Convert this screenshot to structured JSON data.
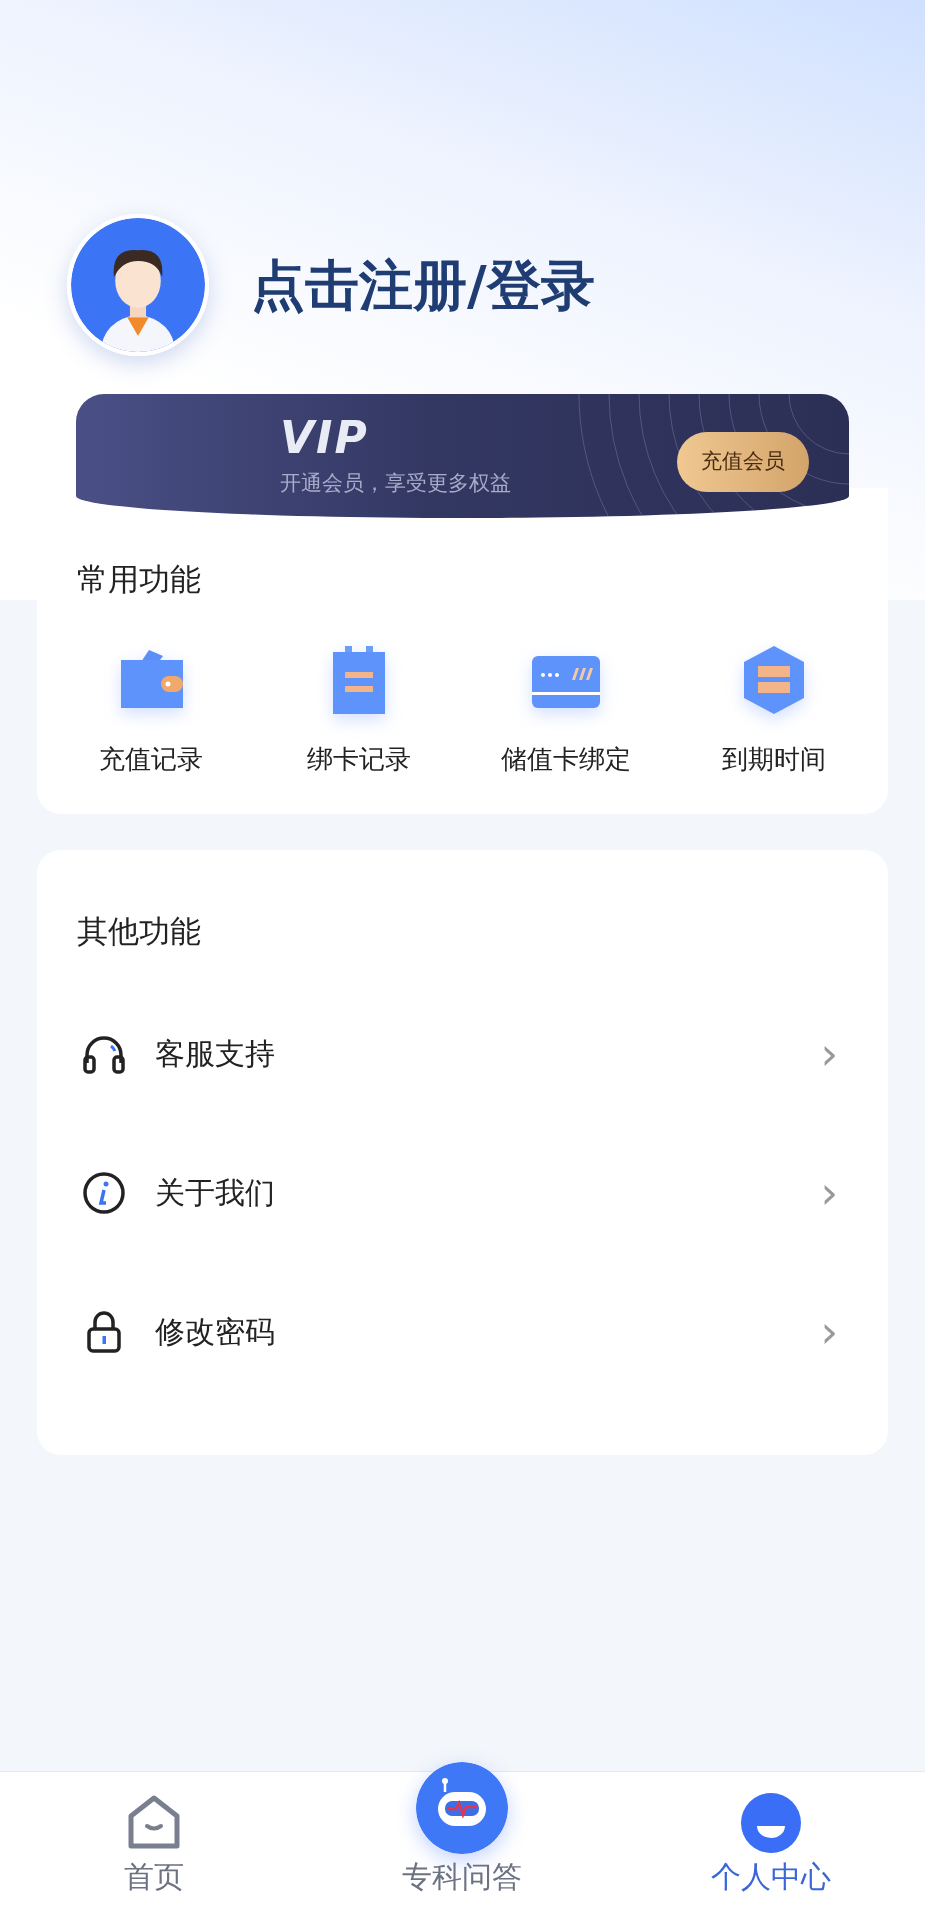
{
  "profile": {
    "title": "点击注册/登录"
  },
  "vip": {
    "logo": "VIP",
    "subtitle": "开通会员，享受更多权益",
    "button": "充值会员"
  },
  "common": {
    "title": "常用功能",
    "items": [
      {
        "label": "充值记录"
      },
      {
        "label": "绑卡记录"
      },
      {
        "label": "储值卡绑定"
      },
      {
        "label": "到期时间"
      }
    ]
  },
  "other": {
    "title": "其他功能",
    "items": [
      {
        "label": "客服支持",
        "chevron": "›"
      },
      {
        "label": "关于我们",
        "chevron": "›"
      },
      {
        "label": "修改密码",
        "chevron": "›"
      }
    ]
  },
  "tabbar": [
    {
      "label": "首页",
      "selected": false
    },
    {
      "label": "专科问答",
      "selected": false
    },
    {
      "label": "个人中心",
      "selected": true
    }
  ]
}
